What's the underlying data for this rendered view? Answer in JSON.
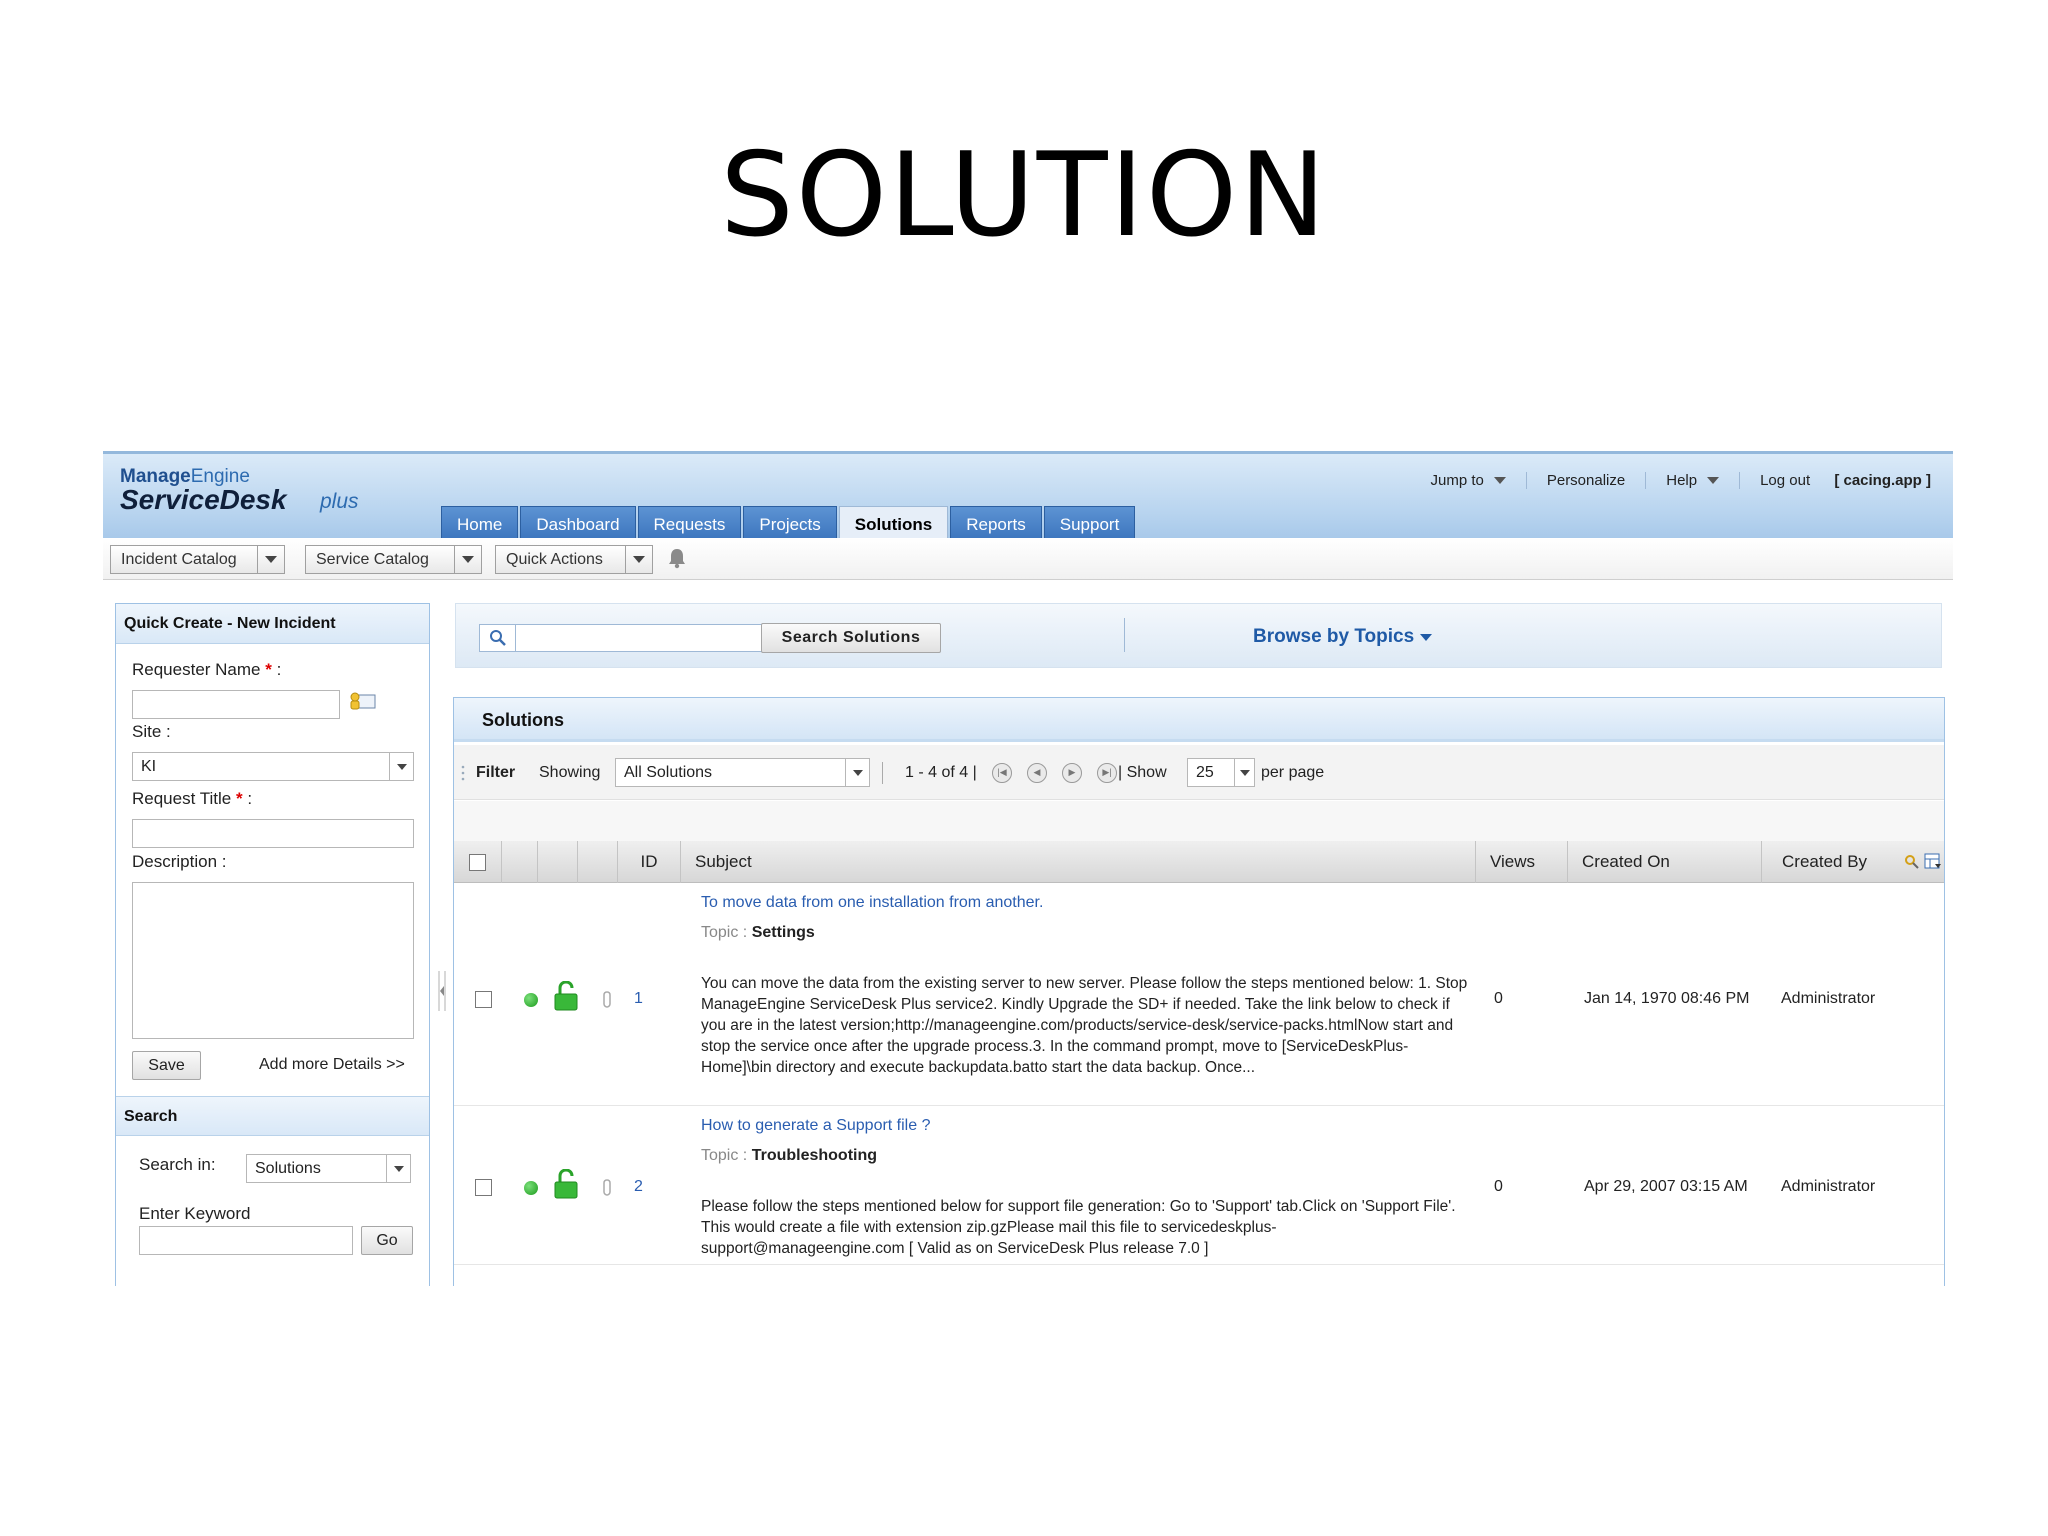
{
  "slide": {
    "title": "SOLUTION"
  },
  "header": {
    "logo_manage": "Manage",
    "logo_engine": "Engine",
    "logo_product": "ServiceDesk",
    "logo_plus": "plus",
    "jump_to": "Jump to",
    "personalize": "Personalize",
    "help": "Help",
    "logout_prefix": "Log out",
    "logout_user": "[ cacing.app ]",
    "tabs": [
      "Home",
      "Dashboard",
      "Requests",
      "Projects",
      "Solutions",
      "Reports",
      "Support"
    ],
    "active_tab": "Solutions"
  },
  "toolbar": {
    "incident_catalog": "Incident Catalog",
    "service_catalog": "Service Catalog",
    "quick_actions": "Quick Actions"
  },
  "quick_create": {
    "title": "Quick Create - New Incident",
    "requester_label": "Requester Name",
    "required_mark": "*",
    "colon": ":",
    "site_label": "Site :",
    "site_value": "KI",
    "request_title_label": "Request Title",
    "description_label": "Description :",
    "save": "Save",
    "add_more": "Add more Details >>"
  },
  "search_panel": {
    "title": "Search",
    "search_in_label": "Search in:",
    "search_in_value": "Solutions",
    "keyword_label": "Enter Keyword",
    "go": "Go"
  },
  "search_bar": {
    "button": "Search Solutions",
    "browse": "Browse by Topics"
  },
  "solutions": {
    "title": "Solutions",
    "filter_label": "Filter",
    "showing_label": "Showing",
    "showing_value": "All Solutions",
    "range": "1 - 4 of 4 |",
    "show_label": "| Show",
    "per_page_value": "25",
    "per_page_label": "per page",
    "columns": {
      "id": "ID",
      "subject": "Subject",
      "views": "Views",
      "created_on": "Created On",
      "created_by": "Created By"
    },
    "rows": [
      {
        "id": "1",
        "subject": "To move data from one installation from another.",
        "topic_label": "Topic :",
        "topic": "Settings",
        "description": "You can move the data from the existing server to new server. Please follow the steps mentioned below: 1. Stop ManageEngine ServiceDesk Plus service2. Kindly Upgrade the SD+ if needed. Take the link below to check if you are in the latest version;http://manageengine.com/products/service-desk/service-packs.htmlNow start and stop the service once after the upgrade process.3. In the command prompt, move to [ServiceDeskPlus-Home]\\bin directory and execute backupdata.batto start the data backup. Once...",
        "views": "0",
        "created_on": "Jan 14, 1970 08:46 PM",
        "created_by": "Administrator"
      },
      {
        "id": "2",
        "subject": "How to generate a Support file ?",
        "topic_label": "Topic :",
        "topic": "Troubleshooting",
        "description": "Please follow the steps mentioned below for support file generation: Go to 'Support' tab.Click on 'Support File'. This would create a file with extension zip.gzPlease mail this file to servicedeskplus-support@manageengine.com [ Valid as on ServiceDesk Plus release 7.0 ]",
        "views": "0",
        "created_on": "Apr 29, 2007 03:15 AM",
        "created_by": "Administrator"
      }
    ]
  },
  "colors": {
    "tab_blue": "#3b74bd",
    "link_blue": "#2a5db0",
    "status_green": "#1c9a1c",
    "required_red": "#dd0000"
  },
  "icons": [
    "search-icon",
    "bell-icon",
    "requester-lookup-icon",
    "status-dot-icon",
    "lock-open-icon",
    "attachment-icon",
    "pagination-first-icon",
    "pagination-prev-icon",
    "pagination-next-icon",
    "pagination-last-icon",
    "column-search-icon",
    "column-chooser-icon"
  ]
}
